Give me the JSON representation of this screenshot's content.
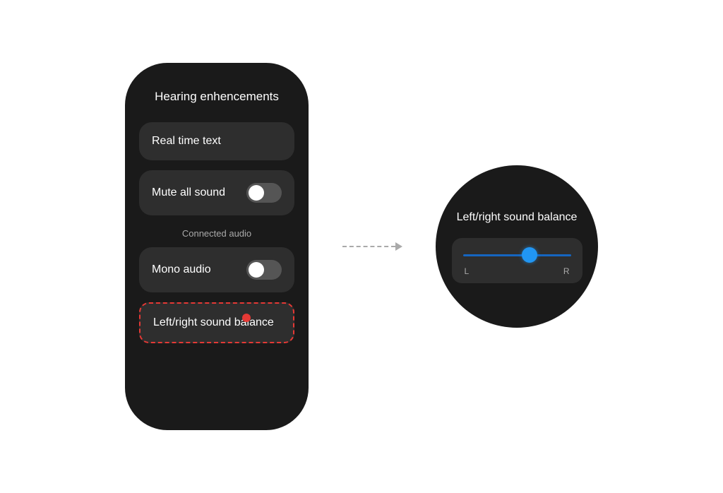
{
  "panel": {
    "title": "Hearing enhencements",
    "items": [
      {
        "id": "real-time-text",
        "label": "Real time text",
        "hasToggle": false
      },
      {
        "id": "mute-all-sound",
        "label": "Mute all sound",
        "hasToggle": true
      },
      {
        "id": "mono-audio",
        "label": "Mono audio",
        "hasToggle": true
      },
      {
        "id": "left-right-balance",
        "label": "Left/right sound balance",
        "hasToggle": false,
        "highlighted": true
      }
    ],
    "section_label": "Connected audio"
  },
  "circle_panel": {
    "title": "Left/right sound\nbalance",
    "slider": {
      "label_left": "L",
      "label_right": "R",
      "value": 65
    }
  },
  "arrow": {
    "type": "dashed"
  }
}
